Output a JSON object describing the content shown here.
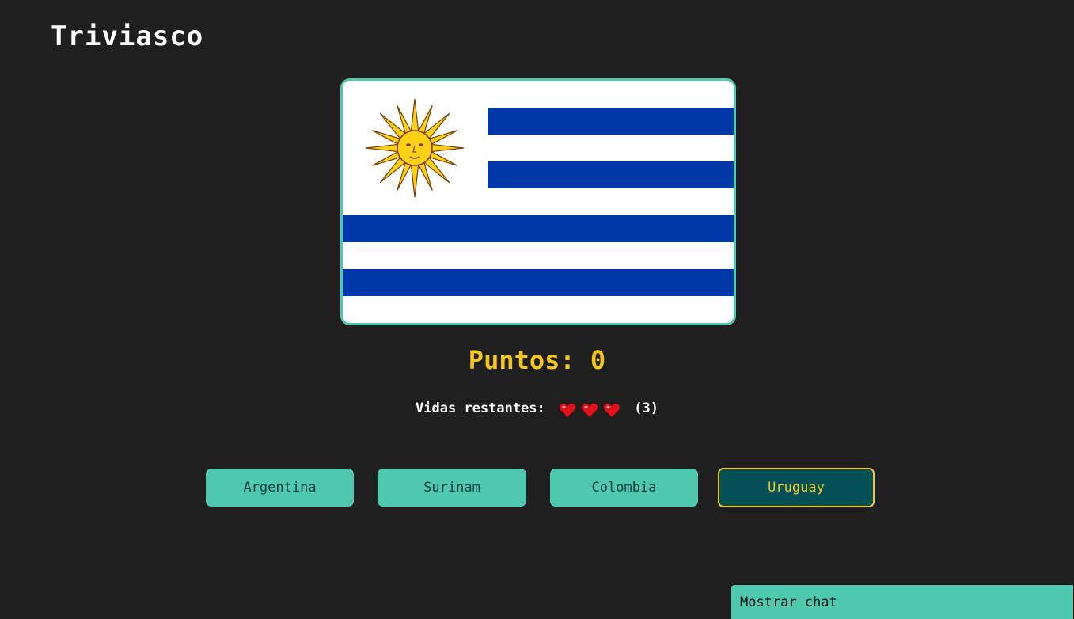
{
  "app": {
    "title": "Triviasco"
  },
  "question": {
    "flag_icon": "uruguay-flag-icon",
    "flag_colors": {
      "blue": "#0038a8",
      "white": "#ffffff",
      "sun": "#fcd116",
      "sun_outline": "#7b3f00"
    }
  },
  "score": {
    "label": "Puntos: 0",
    "value": 0
  },
  "lives": {
    "label": "Vidas restantes:",
    "count_text": "(3)",
    "count": 3,
    "heart_icon": "heart-icon",
    "heart_color": "#e0121b"
  },
  "answers": [
    {
      "label": "Argentina",
      "selected": false
    },
    {
      "label": "Surinam",
      "selected": false
    },
    {
      "label": "Colombia",
      "selected": false
    },
    {
      "label": "Uruguay",
      "selected": true
    }
  ],
  "chat": {
    "toggle_label": "Mostrar chat"
  },
  "colors": {
    "background": "#1f1f1f",
    "accent": "#4ec9b0",
    "highlight": "#f5c518",
    "selected_bg": "#035156"
  }
}
